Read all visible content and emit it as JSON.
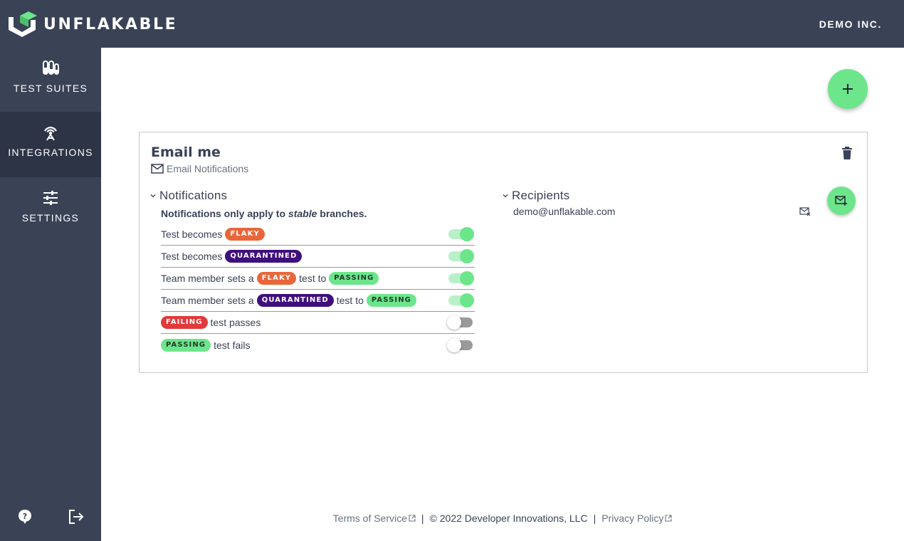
{
  "brand": {
    "name": "UNFLAKABLE",
    "org": "DEMO INC."
  },
  "colors": {
    "navy": "#3a4256",
    "green": "#6de58b",
    "flaky": "#e8663a",
    "quarantined": "#3f0f7d",
    "failing": "#e2393a"
  },
  "sidebar": {
    "items": [
      {
        "label": "TEST SUITES",
        "icon": "test-tubes-icon",
        "active": false
      },
      {
        "label": "INTEGRATIONS",
        "icon": "antenna-icon",
        "active": true
      },
      {
        "label": "SETTINGS",
        "icon": "sliders-icon",
        "active": false
      }
    ],
    "footer_icons": [
      "help-icon",
      "logout-icon"
    ]
  },
  "actions": {
    "add_icon": "plus-icon"
  },
  "integration": {
    "title": "Email me",
    "subtitle": "Email Notifications",
    "subtitle_icon": "mail-icon",
    "delete_icon": "trash-icon",
    "notifications": {
      "heading": "Notifications",
      "note_prefix": "Notifications only apply to ",
      "note_emphasis": "stable",
      "note_suffix": " branches.",
      "rows": [
        {
          "parts": [
            "Test becomes"
          ],
          "badges": [
            "FLAKY"
          ],
          "enabled": true
        },
        {
          "parts": [
            "Test becomes"
          ],
          "badges": [
            "QUARANTINED"
          ],
          "enabled": true
        },
        {
          "parts": [
            "Team member sets a",
            "test to"
          ],
          "badges": [
            "FLAKY",
            "PASSING"
          ],
          "enabled": true
        },
        {
          "parts": [
            "Team member sets a",
            "test to"
          ],
          "badges": [
            "QUARANTINED",
            "PASSING"
          ],
          "enabled": true
        },
        {
          "parts": [
            "test passes"
          ],
          "badges": [
            "FAILING"
          ],
          "enabled": false
        },
        {
          "parts": [
            "test fails"
          ],
          "badges": [
            "PASSING"
          ],
          "enabled": false
        }
      ]
    },
    "recipients": {
      "heading": "Recipients",
      "emails": [
        "demo@unflakable.com"
      ],
      "remove_icon": "mail-remove-icon",
      "add_icon": "mail-add-icon"
    }
  },
  "footer": {
    "terms": "Terms of Service",
    "copyright": "© 2022 Developer Innovations, LLC",
    "privacy": "Privacy Policy"
  }
}
